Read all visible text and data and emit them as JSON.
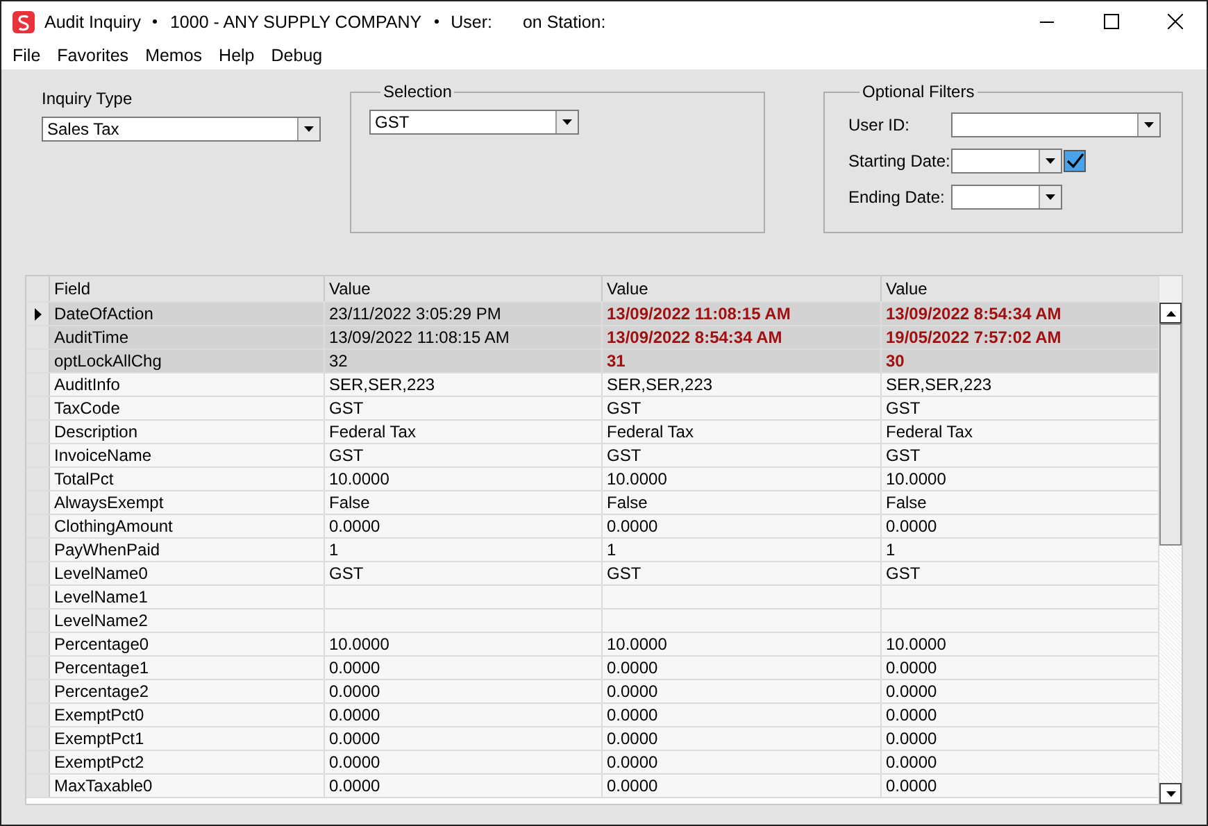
{
  "window": {
    "title_parts": [
      "Audit Inquiry",
      "1000 - ANY SUPPLY COMPANY",
      "User:",
      "on Station:"
    ]
  },
  "menu": [
    "File",
    "Favorites",
    "Memos",
    "Help",
    "Debug"
  ],
  "inquiry_type": {
    "label": "Inquiry Type",
    "value": "Sales Tax"
  },
  "selection": {
    "label": "Selection",
    "value": "GST"
  },
  "optional_filters": {
    "label": "Optional Filters",
    "user_id_label": "User ID:",
    "starting_date_label": "Starting Date:",
    "starting_date_checked": true,
    "ending_date_label": "Ending Date:"
  },
  "table": {
    "columns": [
      "Field",
      "Value",
      "Value",
      "Value"
    ],
    "rows": [
      {
        "field": "DateOfAction",
        "values": [
          "23/11/2022 3:05:29 PM",
          "13/09/2022 11:08:15 AM",
          "13/09/2022 8:54:34 AM"
        ],
        "changed": true,
        "current": true
      },
      {
        "field": "AuditTime",
        "values": [
          "13/09/2022 11:08:15 AM",
          "13/09/2022 8:54:34 AM",
          "19/05/2022 7:57:02 AM"
        ],
        "changed": true,
        "current": false
      },
      {
        "field": "optLockAllChg",
        "values": [
          "32",
          "31",
          "30"
        ],
        "changed": true,
        "current": false
      },
      {
        "field": "AuditInfo",
        "values": [
          "SER,SER,223",
          "SER,SER,223",
          "SER,SER,223"
        ],
        "changed": false,
        "current": false
      },
      {
        "field": "TaxCode",
        "values": [
          "GST",
          "GST",
          "GST"
        ],
        "changed": false,
        "current": false
      },
      {
        "field": "Description",
        "values": [
          "Federal Tax",
          "Federal Tax",
          "Federal Tax"
        ],
        "changed": false,
        "current": false
      },
      {
        "field": "InvoiceName",
        "values": [
          "GST",
          "GST",
          "GST"
        ],
        "changed": false,
        "current": false
      },
      {
        "field": "TotalPct",
        "values": [
          "10.0000",
          "10.0000",
          "10.0000"
        ],
        "changed": false,
        "current": false
      },
      {
        "field": "AlwaysExempt",
        "values": [
          "False",
          "False",
          "False"
        ],
        "changed": false,
        "current": false
      },
      {
        "field": "ClothingAmount",
        "values": [
          "0.0000",
          "0.0000",
          "0.0000"
        ],
        "changed": false,
        "current": false
      },
      {
        "field": "PayWhenPaid",
        "values": [
          "1",
          "1",
          "1"
        ],
        "changed": false,
        "current": false
      },
      {
        "field": "LevelName0",
        "values": [
          "GST",
          "GST",
          "GST"
        ],
        "changed": false,
        "current": false
      },
      {
        "field": "LevelName1",
        "changed": false,
        "current": false
      },
      {
        "field": "LevelName2",
        "changed": false,
        "current": false
      },
      {
        "field": "Percentage0",
        "values": [
          "10.0000",
          "10.0000",
          "10.0000"
        ],
        "changed": false,
        "current": false
      },
      {
        "field": "Percentage1",
        "values": [
          "0.0000",
          "0.0000",
          "0.0000"
        ],
        "changed": false,
        "current": false
      },
      {
        "field": "Percentage2",
        "values": [
          "0.0000",
          "0.0000",
          "0.0000"
        ],
        "changed": false,
        "current": false
      },
      {
        "field": "ExemptPct0",
        "values": [
          "0.0000",
          "0.0000",
          "0.0000"
        ],
        "changed": false,
        "current": false
      },
      {
        "field": "ExemptPct1",
        "values": [
          "0.0000",
          "0.0000",
          "0.0000"
        ],
        "changed": false,
        "current": false
      },
      {
        "field": "ExemptPct2",
        "values": [
          "0.0000",
          "0.0000",
          "0.0000"
        ],
        "changed": false,
        "current": false
      },
      {
        "field": "MaxTaxable0",
        "values": [
          "0.0000",
          "0.0000",
          "0.0000"
        ],
        "changed": false,
        "current": false
      }
    ]
  }
}
